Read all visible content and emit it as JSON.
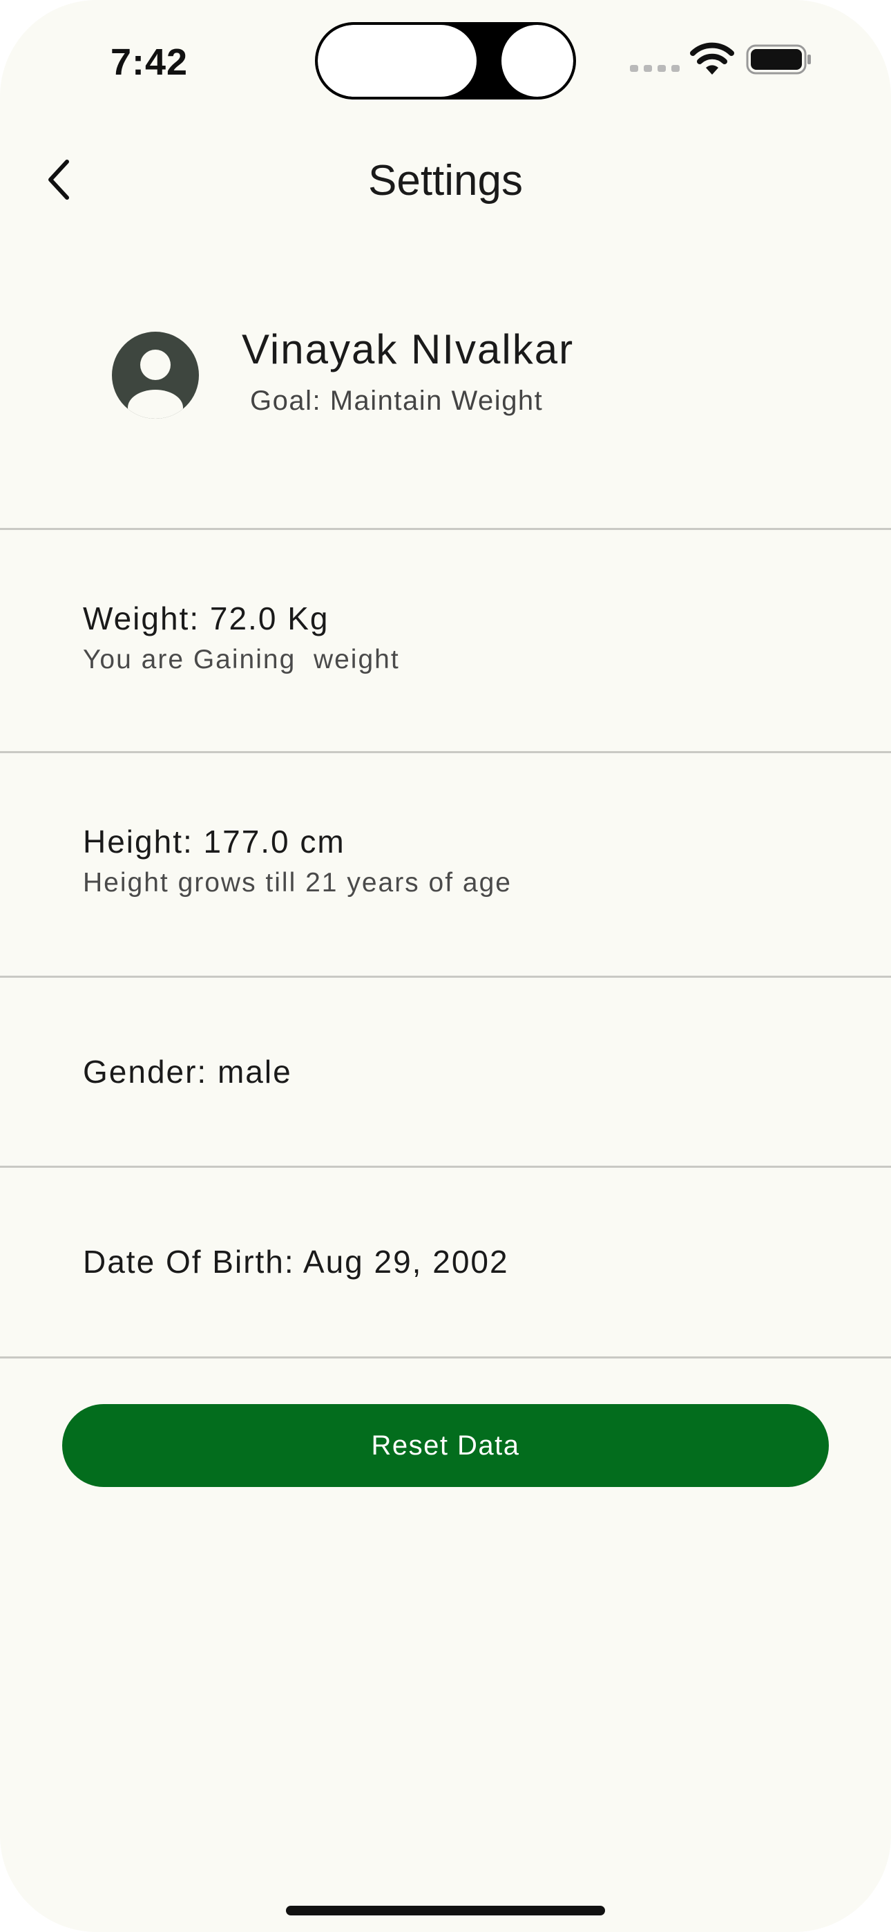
{
  "status_bar": {
    "time": "7:42"
  },
  "nav": {
    "title": "Settings",
    "back_icon": "chevron-left-icon"
  },
  "profile": {
    "name": "Vinayak NIvalkar",
    "goal": "Goal: Maintain Weight",
    "avatar_icon": "person-avatar-icon"
  },
  "rows": [
    {
      "title": "Weight: 72.0 Kg",
      "subtitle": "You are Gaining  weight"
    },
    {
      "title": "Height: 177.0 cm",
      "subtitle": "Height grows till 21 years of age"
    },
    {
      "title": "Gender: male"
    },
    {
      "title": "Date Of Birth: Aug 29, 2002"
    }
  ],
  "reset_button": {
    "label": "Reset Data"
  },
  "colors": {
    "background": "#fafaf4",
    "accent": "#036d1d",
    "divider": "#c9c9c4",
    "avatar": "#3e463f"
  }
}
